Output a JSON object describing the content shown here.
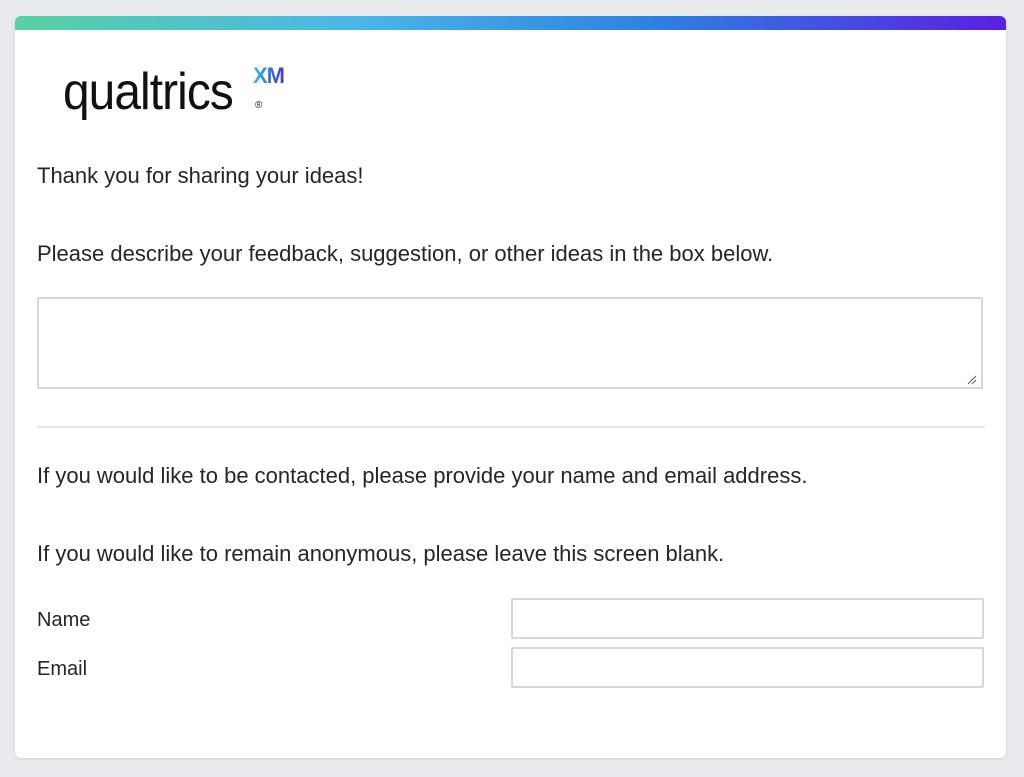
{
  "brand": {
    "name": "qualtrics",
    "suffix": "XM",
    "registered_mark": "®",
    "top_bar_colors": [
      "#5ad0a4",
      "#49b6e8",
      "#2f7fe0",
      "#5a1fe0"
    ]
  },
  "survey": {
    "thank_you_text": "Thank you for sharing your ideas!",
    "feedback_prompt": "Please describe your feedback, suggestion, or other ideas in the box below.",
    "feedback_value": "",
    "contact_prompt": "If you would like to be contacted, please provide your name and email address.",
    "anonymous_prompt": "If you would like to remain anonymous, please leave this screen blank.",
    "fields": {
      "name_label": "Name",
      "name_value": "",
      "email_label": "Email",
      "email_value": ""
    }
  }
}
